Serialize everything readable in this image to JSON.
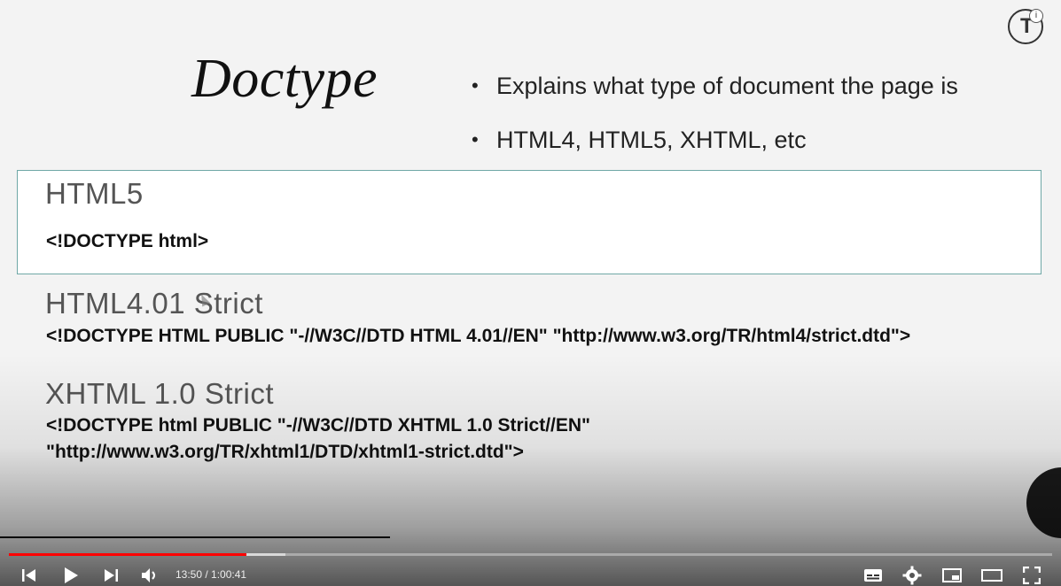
{
  "slide": {
    "title": "Doctype",
    "bullets": [
      "Explains what type of document the page is",
      "HTML4, HTML5, XHTML, etc"
    ],
    "bullet_char": "•",
    "sections": [
      {
        "heading": "HTML5",
        "code": [
          "<!DOCTYPE html>"
        ]
      },
      {
        "heading": "HTML4.01 Strict",
        "code": [
          "<!DOCTYPE HTML PUBLIC \"-//W3C//DTD HTML 4.01//EN\" \"http://www.w3.org/TR/html4/strict.dtd\">"
        ]
      },
      {
        "heading": "XHTML 1.0 Strict",
        "code": [
          "<!DOCTYPE html PUBLIC \"-//W3C//DTD XHTML 1.0 Strict//EN\"",
          "\"http://www.w3.org/TR/xhtml1/DTD/xhtml1-strict.dtd\">"
        ]
      }
    ],
    "box_border_color": "#6fa8a6"
  },
  "player": {
    "time_display": "13:50 / 1:00:41",
    "progress_played_fraction": 0.228,
    "progress_loaded_fraction": 0.265,
    "played_color": "#ff0000",
    "icons": {
      "previous": "skip-previous-icon",
      "play": "play-icon",
      "next": "skip-next-icon",
      "volume": "volume-icon",
      "subtitles": "subtitles-icon",
      "settings": "gear-icon",
      "miniplayer": "miniplayer-icon",
      "theater": "theater-mode-icon",
      "fullscreen": "fullscreen-icon"
    },
    "channel_logo_letter": "T",
    "info_badge": "i"
  }
}
